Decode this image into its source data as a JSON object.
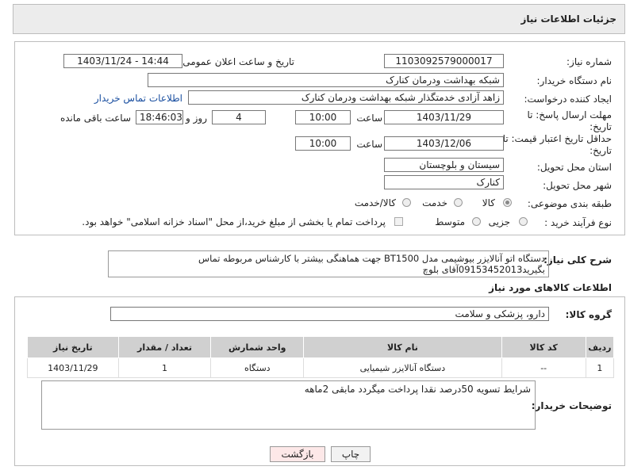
{
  "header": {
    "title": "جزئیات اطلاعات نیاز"
  },
  "need": {
    "number_label": "شماره نیاز:",
    "number": "1103092579000017",
    "announce_label": "تاریخ و ساعت اعلان عمومی:",
    "announce_value": "1403/11/24 - 14:44",
    "buyer_label": "نام دستگاه خریدار:",
    "buyer_value": "شبکه بهداشت ودرمان کنارک",
    "creator_label": "ایجاد کننده درخواست:",
    "creator_value": "زاهد  آزادی خدمتگذار شبکه بهداشت ودرمان کنارک",
    "contact_link": "اطلاعات تماس خریدار",
    "deadline_label": "مهلت ارسال پاسخ: تا تاریخ:",
    "deadline_date": "1403/11/29",
    "time_label": "ساعت",
    "deadline_time": "10:00",
    "days_value": "4",
    "days_label": "روز و",
    "remaining_time": "18:46:03",
    "remaining_label": "ساعت باقی مانده",
    "price_validity_label": "حداقل تاریخ اعتبار قیمت: تا تاریخ:",
    "price_validity_date": "1403/12/06",
    "price_validity_time": "10:00",
    "province_label": "استان محل تحویل:",
    "province_value": "سیستان و بلوچستان",
    "city_label": "شهر محل تحویل:",
    "city_value": "کنارک",
    "category_label": "طبقه بندی موضوعی:",
    "category_options": [
      "کالا",
      "خدمت",
      "کالا/خدمت"
    ],
    "category_selected": "کالا",
    "process_label": "نوع فرآیند خرید :",
    "process_options": [
      "جزیی",
      "متوسط"
    ],
    "payment_note": "پرداخت تمام یا بخشی از مبلغ خرید،از محل \"اسناد خزانه اسلامی\" خواهد بود."
  },
  "description": {
    "label": "شرح کلی نیاز:",
    "text_line1": "دستگاه اتو آنالایزر بیوشیمی مدل BT1500 جهت هماهنگی بیشتر با کارشناس مربوطه تماس",
    "text_line2": "بگیرید09153452013آقای بلوچ"
  },
  "goods_section": {
    "title": "اطلاعات کالاهای مورد نیاز",
    "group_label": "گروه کالا:",
    "group_value": "دارو، پزشکی و سلامت",
    "columns": [
      "ردیف",
      "کد کالا",
      "نام کالا",
      "واحد شمارش",
      "تعداد / مقدار",
      "تاریخ نیاز"
    ],
    "rows": [
      {
        "row": "1",
        "code": "--",
        "name": "دستگاه آنالایزر شیمیایی",
        "unit": "دستگاه",
        "qty": "1",
        "date": "1403/11/29"
      }
    ]
  },
  "buyer_notes": {
    "label": "توضیحات خریدار:",
    "text": "شرایط تسویه 50درصد نقدا پرداخت میگردد مابقی 2ماهه"
  },
  "buttons": {
    "print": "چاپ",
    "back": "بازگشت"
  },
  "colors": {
    "header_bg": "#ececec",
    "table_header_bg": "#d0d0d0",
    "link": "#1a4fa0",
    "back_button_bg": "#fde8e8"
  }
}
